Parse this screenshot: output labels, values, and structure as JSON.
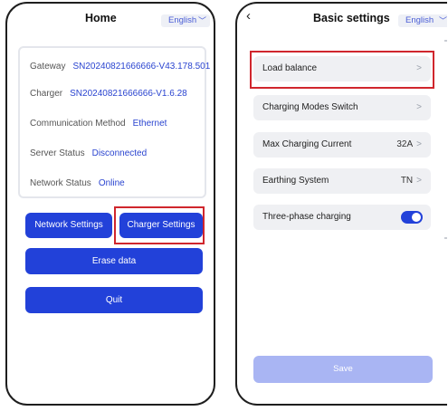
{
  "home": {
    "title": "Home",
    "language": "English",
    "info": {
      "gateway_label": "Gateway",
      "gateway_value": "SN20240821666666-V43.178.501",
      "charger_label": "Charger",
      "charger_value": "SN20240821666666-V1.6.28",
      "comm_label": "Communication Method",
      "comm_value": "Ethernet",
      "server_label": "Server Status",
      "server_value": "Disconnected",
      "network_label": "Network Status",
      "network_value": "Online"
    },
    "buttons": {
      "network_settings": "Network Settings",
      "charger_settings": "Charger Settings",
      "erase_data": "Erase data",
      "quit": "Quit"
    }
  },
  "basic": {
    "title": "Basic settings",
    "language": "English",
    "items": [
      {
        "label": "Load balance",
        "value": ""
      },
      {
        "label": "Charging Modes Switch",
        "value": ""
      },
      {
        "label": "Max Charging Current",
        "value": "32A"
      },
      {
        "label": "Earthing System",
        "value": "TN"
      },
      {
        "label": "Three-phase charging",
        "value": ""
      }
    ],
    "three_phase_enabled": true,
    "save_label": "Save"
  },
  "colors": {
    "accent": "#2241d9",
    "highlight_box": "#d0262d",
    "save_disabled": "#a9b5f3",
    "value_text": "#2a44d0"
  },
  "icons": {
    "back": "chevron-left-icon",
    "item_arrow": "chevron-right-icon",
    "dropdown": "chevron-down-icon"
  }
}
